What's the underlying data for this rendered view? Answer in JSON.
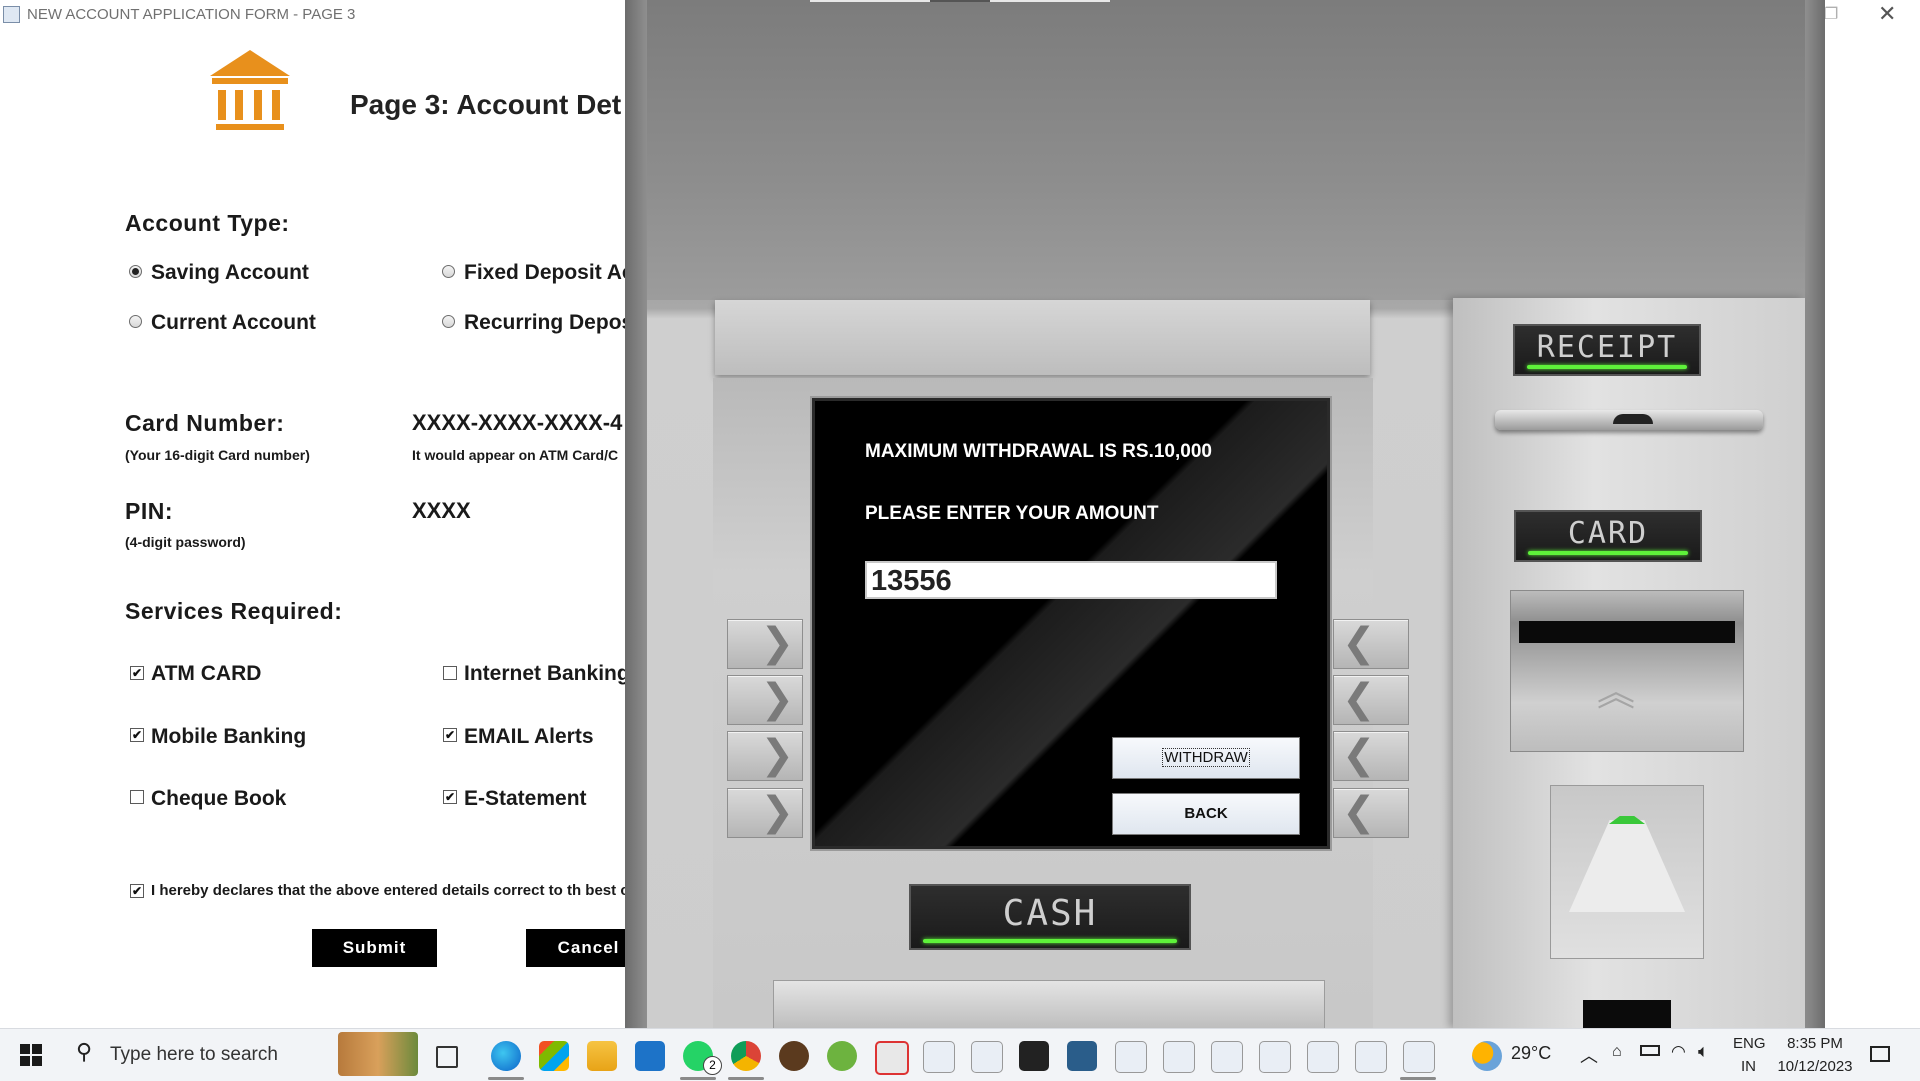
{
  "form_window": {
    "title": "NEW ACCOUNT APPLICATION FORM - PAGE 3",
    "heading": "Page 3: Account Det",
    "account_type_label": "Account Type:",
    "account_types": [
      {
        "label": "Saving Account",
        "selected": true
      },
      {
        "label": "Fixed Deposit Ac",
        "selected": false
      },
      {
        "label": "Current Account",
        "selected": false
      },
      {
        "label": "Recurring Deposi",
        "selected": false
      }
    ],
    "card_number_label": "Card Number:",
    "card_number_hint": "(Your 16-digit Card number)",
    "card_number_value": "XXXX-XXXX-XXXX-4",
    "card_number_note": "It would appear on ATM Card/C",
    "pin_label": "PIN:",
    "pin_hint": "(4-digit password)",
    "pin_value": "XXXX",
    "services_label": "Services Required:",
    "services": [
      {
        "label": "ATM CARD",
        "checked": true
      },
      {
        "label": "Internet Banking",
        "checked": false
      },
      {
        "label": "Mobile Banking",
        "checked": true
      },
      {
        "label": "EMAIL Alerts",
        "checked": true
      },
      {
        "label": "Cheque Book",
        "checked": false
      },
      {
        "label": "E-Statement",
        "checked": true
      }
    ],
    "declaration": "I hereby declares that the above entered details correct to th best c",
    "declaration_checked": true,
    "submit_label": "Submit",
    "cancel_label": "Cancel",
    "check_mark": "✔",
    "logo_color": "#e8901c"
  },
  "atm": {
    "line1": "MAXIMUM WITHDRAWAL IS RS.10,000",
    "line2": "PLEASE ENTER YOUR AMOUNT",
    "amount_value": "13556",
    "withdraw_label": "WITHDRAW",
    "back_label": "BACK",
    "receipt_label": "RECEIPT",
    "card_label": "CARD",
    "cash_label": "CASH",
    "left_key_glyph": "❯",
    "right_key_glyph": "❮",
    "slot_glow_color": "#5ef23a"
  },
  "taskbar": {
    "search_placeholder": "Type here to search",
    "whatsapp_badge": "2",
    "temperature": "29°C",
    "language": "ENG",
    "region": "IN",
    "time": "8:35 PM",
    "date": "10/12/2023"
  }
}
